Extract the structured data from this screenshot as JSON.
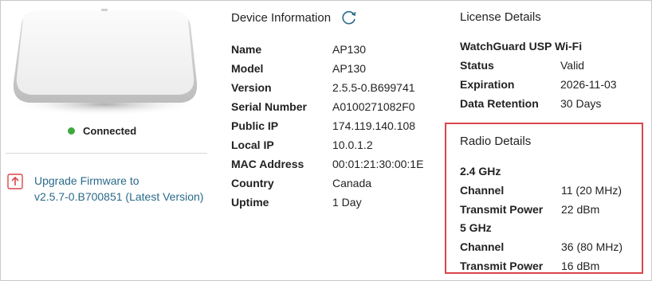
{
  "device": {
    "status_label": "Connected",
    "status_color": "#3fa83f",
    "image_icon": "access-point-device",
    "upgrade_icon": "upload-arrow-icon",
    "upgrade_line1": "Upgrade Firmware to",
    "upgrade_line2": "v2.5.7-0.B700851 (Latest Version)"
  },
  "device_info": {
    "title": "Device Information",
    "refresh_icon": "refresh-icon",
    "rows": [
      {
        "label": "Name",
        "value": "AP130"
      },
      {
        "label": "Model",
        "value": "AP130"
      },
      {
        "label": "Version",
        "value": "2.5.5-0.B699741"
      },
      {
        "label": "Serial Number",
        "value": "A0100271082F0"
      },
      {
        "label": "Public IP",
        "value": "174.119.140.108"
      },
      {
        "label": "Local IP",
        "value": "10.0.1.2"
      },
      {
        "label": "MAC Address",
        "value": "00:01:21:30:00:1E"
      },
      {
        "label": "Country",
        "value": "Canada"
      },
      {
        "label": "Uptime",
        "value": "1 Day"
      }
    ]
  },
  "license": {
    "title": "License Details",
    "product": "WatchGuard USP Wi-Fi",
    "rows": [
      {
        "label": "Status",
        "value": "Valid"
      },
      {
        "label": "Expiration",
        "value": "2026-11-03"
      },
      {
        "label": "Data Retention",
        "value": "30 Days"
      }
    ]
  },
  "radio": {
    "title": "Radio Details",
    "highlight_color": "#d9464a",
    "bands": [
      {
        "name": "2.4 GHz",
        "channel_label": "Channel",
        "channel_value": "11 (20 MHz)",
        "power_label": "Transmit Power",
        "power_value": "22 dBm"
      },
      {
        "name": "5 GHz",
        "channel_label": "Channel",
        "channel_value": "36 (80 MHz)",
        "power_label": "Transmit Power",
        "power_value": "16 dBm"
      }
    ]
  }
}
